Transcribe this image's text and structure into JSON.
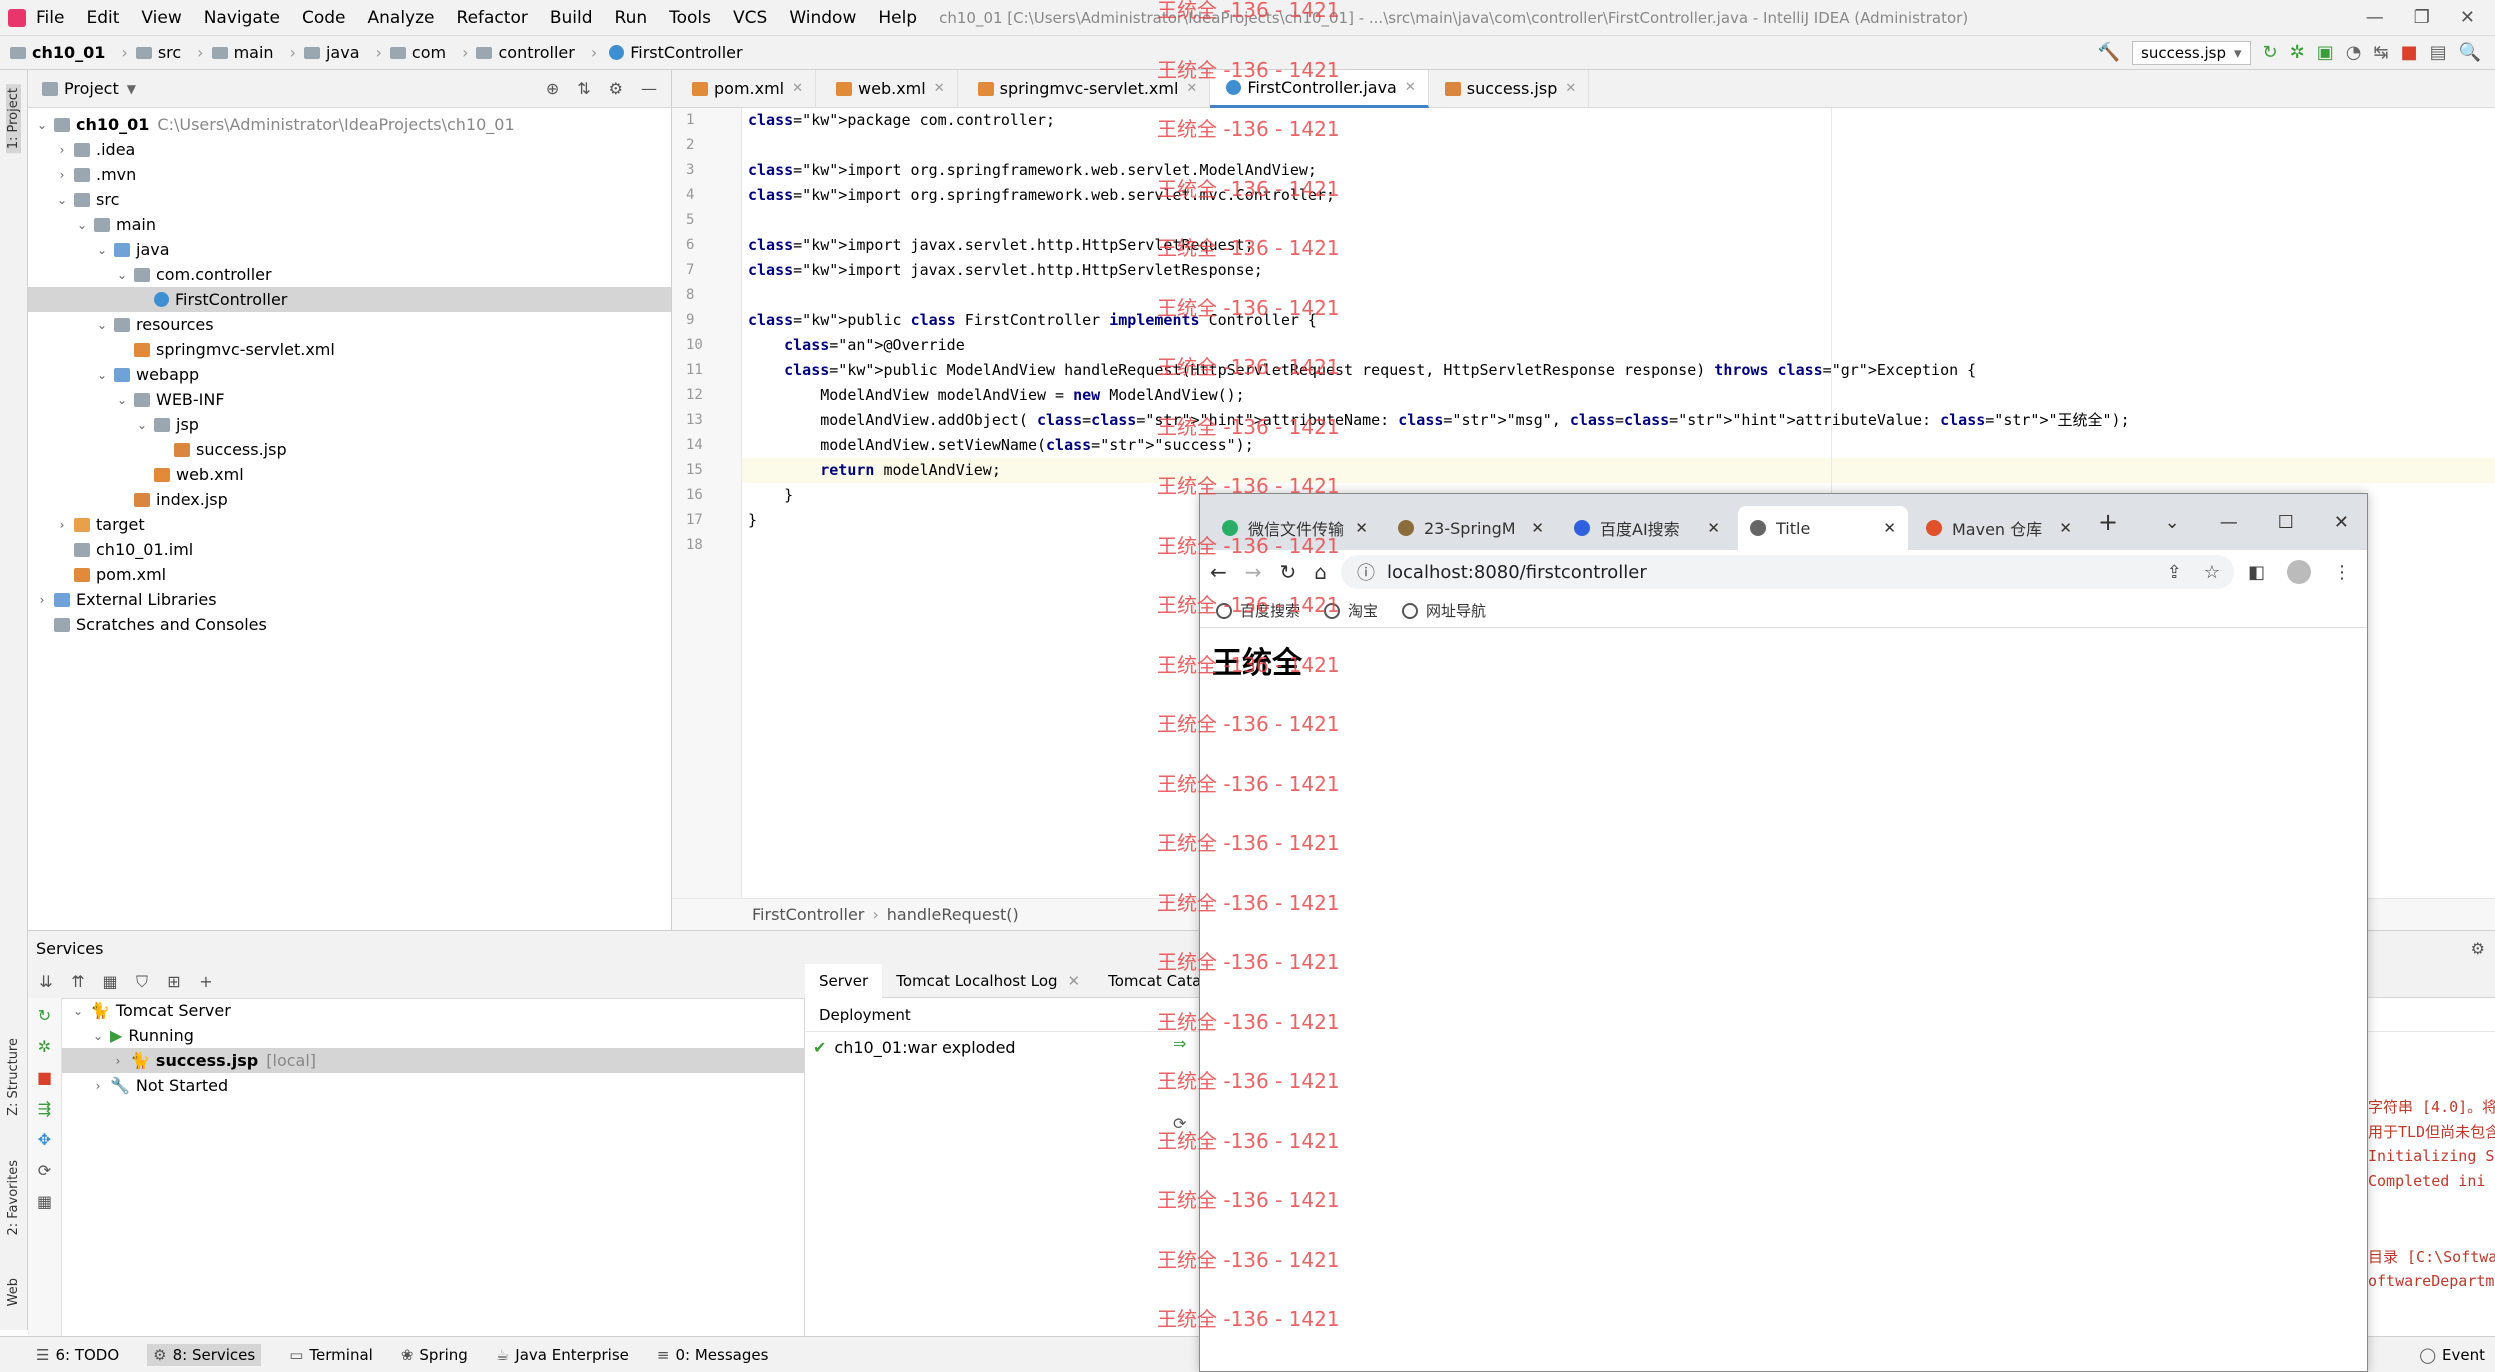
{
  "window": {
    "title": "ch10_01 [C:\\Users\\Administrator\\IdeaProjects\\ch10_01] - ...\\src\\main\\java\\com\\controller\\FirstController.java - IntelliJ IDEA (Administrator)",
    "menu": [
      "File",
      "Edit",
      "View",
      "Navigate",
      "Code",
      "Analyze",
      "Refactor",
      "Build",
      "Run",
      "Tools",
      "VCS",
      "Window",
      "Help"
    ]
  },
  "breadcrumb": [
    "ch10_01",
    "src",
    "main",
    "java",
    "com",
    "controller",
    "FirstController"
  ],
  "run_config": "success.jsp",
  "left_stripe": {
    "project": "1: Project",
    "structure": "Z: Structure",
    "favorites": "2: Favorites",
    "web": "Web"
  },
  "project": {
    "header": "Project",
    "tree": [
      {
        "label": "ch10_01",
        "extra": "C:\\Users\\Administrator\\IdeaProjects\\ch10_01",
        "depth": 0,
        "icon": "folder",
        "open": true
      },
      {
        "label": ".idea",
        "depth": 1,
        "icon": "folder",
        "open": false
      },
      {
        "label": ".mvn",
        "depth": 1,
        "icon": "folder",
        "open": false
      },
      {
        "label": "src",
        "depth": 1,
        "icon": "folder",
        "open": true
      },
      {
        "label": "main",
        "depth": 2,
        "icon": "folder",
        "open": true
      },
      {
        "label": "java",
        "depth": 3,
        "icon": "source-folder",
        "open": true
      },
      {
        "label": "com.controller",
        "depth": 4,
        "icon": "package",
        "open": true
      },
      {
        "label": "FirstController",
        "depth": 5,
        "icon": "class",
        "selected": true
      },
      {
        "label": "resources",
        "depth": 3,
        "icon": "folder",
        "open": true
      },
      {
        "label": "springmvc-servlet.xml",
        "depth": 4,
        "icon": "xml"
      },
      {
        "label": "webapp",
        "depth": 3,
        "icon": "source-folder",
        "open": true
      },
      {
        "label": "WEB-INF",
        "depth": 4,
        "icon": "folder",
        "open": true
      },
      {
        "label": "jsp",
        "depth": 5,
        "icon": "folder",
        "open": true
      },
      {
        "label": "success.jsp",
        "depth": 6,
        "icon": "jsp"
      },
      {
        "label": "web.xml",
        "depth": 5,
        "icon": "xml"
      },
      {
        "label": "index.jsp",
        "depth": 4,
        "icon": "jsp"
      },
      {
        "label": "target",
        "depth": 1,
        "icon": "excluded-folder",
        "open": false
      },
      {
        "label": "ch10_01.iml",
        "depth": 1,
        "icon": "iml"
      },
      {
        "label": "pom.xml",
        "depth": 1,
        "icon": "maven"
      },
      {
        "label": "External Libraries",
        "depth": 0,
        "icon": "libraries",
        "open": false
      },
      {
        "label": "Scratches and Consoles",
        "depth": 0,
        "icon": "scratches"
      }
    ]
  },
  "editor": {
    "tabs": [
      {
        "label": "pom.xml",
        "active": false
      },
      {
        "label": "web.xml",
        "active": false
      },
      {
        "label": "springmvc-servlet.xml",
        "active": false
      },
      {
        "label": "FirstController.java",
        "active": true
      },
      {
        "label": "success.jsp",
        "active": false
      }
    ],
    "line_numbers": [
      "1",
      "2",
      "3",
      "4",
      "5",
      "6",
      "7",
      "8",
      "9",
      "10",
      "11",
      "12",
      "13",
      "14",
      "15",
      "16",
      "17",
      "18"
    ],
    "code": [
      "package com.controller;",
      "",
      "import org.springframework.web.servlet.ModelAndView;",
      "import org.springframework.web.servlet.mvc.Controller;",
      "",
      "import javax.servlet.http.HttpServletRequest;",
      "import javax.servlet.http.HttpServletResponse;",
      "",
      "public class FirstController implements Controller {",
      "    @Override",
      "    public ModelAndView handleRequest(HttpServletRequest request, HttpServletResponse response) throws Exception {",
      "        ModelAndView modelAndView = new ModelAndView();",
      "        modelAndView.addObject( attributeName: \"msg\", attributeValue: \"王统全\");",
      "        modelAndView.setViewName(\"success\");",
      "        return modelAndView;",
      "    }",
      "}",
      ""
    ],
    "footer_breadcrumb": [
      "FirstController",
      "handleRequest()"
    ]
  },
  "services": {
    "title": "Services",
    "tree": [
      {
        "label": "Tomcat Server",
        "depth": 0
      },
      {
        "label": "Running",
        "depth": 1
      },
      {
        "label": "success.jsp",
        "extra": "[local]",
        "depth": 2,
        "selected": true
      },
      {
        "label": "Not Started",
        "depth": 1
      }
    ],
    "right_tabs": [
      "Server",
      "Tomcat Localhost Log",
      "Tomcat Cata"
    ],
    "deployment_header": "Deployment",
    "deployment_item": "ch10_01:war exploded",
    "console_lines": [
      "字符串 [4.0]。将",
      "用于TLD但尚未包含",
      "Initializing S",
      "Completed ini",
      "目录 [C:\\Softwar",
      "oftwareDepartme"
    ]
  },
  "statusbar": [
    "6: TODO",
    "8: Services",
    "Terminal",
    "Spring",
    "Java Enterprise",
    "0: Messages",
    "Event"
  ],
  "browser": {
    "tabs": [
      {
        "label": "微信文件传输",
        "color": "#2aae67"
      },
      {
        "label": "23-SpringM",
        "color": "#8a6d3b"
      },
      {
        "label": "百度AI搜索",
        "color": "#3060e0"
      },
      {
        "label": "Title",
        "color": "#666666",
        "active": true
      },
      {
        "label": "Maven 仓库",
        "color": "#e0502a"
      }
    ],
    "url": "localhost:8080/firstcontroller",
    "bookmarks": [
      "百度搜索",
      "淘宝",
      "网址导航"
    ],
    "content": "王统全"
  },
  "watermark": "王统全 -136 - 1421",
  "colors": {
    "accent": "#4083c9",
    "watermark": "#e8484a",
    "run_green": "#3a9d3a",
    "stop_red": "#d9412d"
  }
}
